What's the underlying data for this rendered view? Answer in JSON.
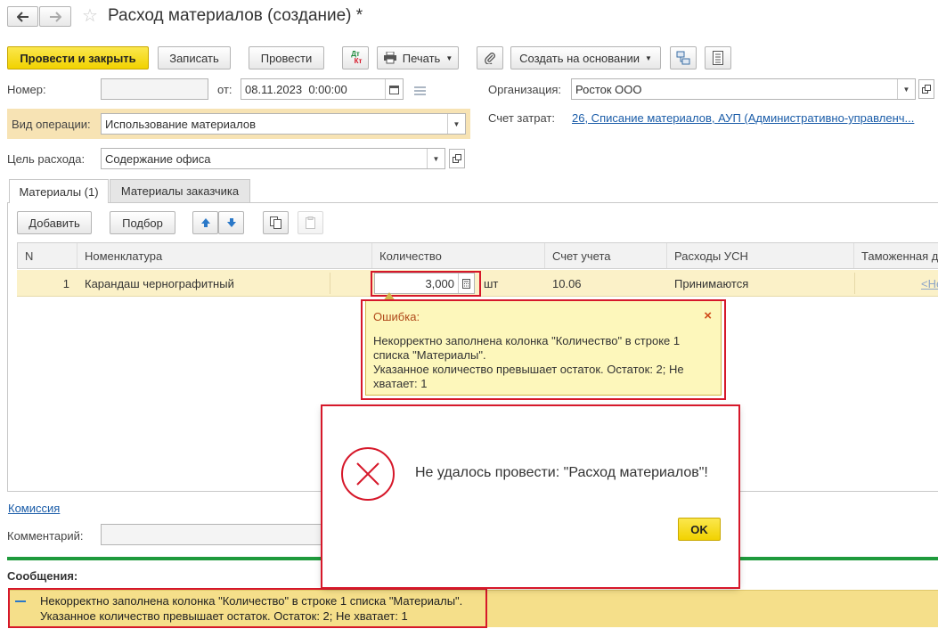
{
  "window": {
    "title": "Расход материалов (создание) *"
  },
  "toolbar": {
    "post_and_close": "Провести и закрыть",
    "save": "Записать",
    "post": "Провести",
    "dtkt_top": "Дт",
    "dtkt_bottom": "Кт",
    "print": "Печать",
    "create_based_on": "Создать на основании"
  },
  "header": {
    "number_label": "Номер:",
    "number_value": "",
    "date_label": "от:",
    "date_value": "08.11.2023  0:00:00",
    "org_label": "Организация:",
    "org_value": "Росток ООО",
    "op_label": "Вид операции:",
    "op_value": "Использование материалов",
    "account_label": "Счет затрат:",
    "account_value": "26, Списание материалов, АУП (Административно-управленч...",
    "purpose_label": "Цель расхода:",
    "purpose_value": "Содержание офиса"
  },
  "tabs": [
    {
      "label": "Материалы (1)"
    },
    {
      "label": "Материалы заказчика"
    }
  ],
  "table_toolbar": {
    "add": "Добавить",
    "select": "Подбор"
  },
  "table": {
    "columns": [
      "N",
      "Номенклатура",
      "Количество",
      "Счет учета",
      "Расходы УСН",
      "Таможенная д"
    ],
    "row": {
      "n": "1",
      "item": "Карандаш чернографитный",
      "qty": "3,000",
      "unit": "шт",
      "account": "10.06",
      "usn": "Принимаются",
      "customs": "<Не"
    }
  },
  "tooltip": {
    "title": "Ошибка:",
    "line1": "Некорректно заполнена колонка \"Количество\" в строке 1",
    "line2": "списка \"Материалы\".",
    "line3": "Указанное количество превышает остаток. Остаток: 2; Не",
    "line4": "хватает: 1"
  },
  "dialog": {
    "message": "Не удалось провести: \"Расход материалов\"!",
    "ok": "OK"
  },
  "footer": {
    "commission_link": "Комиссия",
    "comment_label": "Комментарий:",
    "messages_title": "Сообщения:",
    "msg_line1": "Некорректно заполнена колонка \"Количество\" в строке 1 списка \"Материалы\".",
    "msg_line2": "Указанное количество превышает остаток. Остаток: 2; Не хватает: 1"
  },
  "colors": {
    "accent_yellow": "#f5d614",
    "error_red": "#d6182a",
    "link_blue": "#1a5ca8",
    "row_highlight": "#fbf1c8",
    "status_green": "#1e9a3c"
  }
}
